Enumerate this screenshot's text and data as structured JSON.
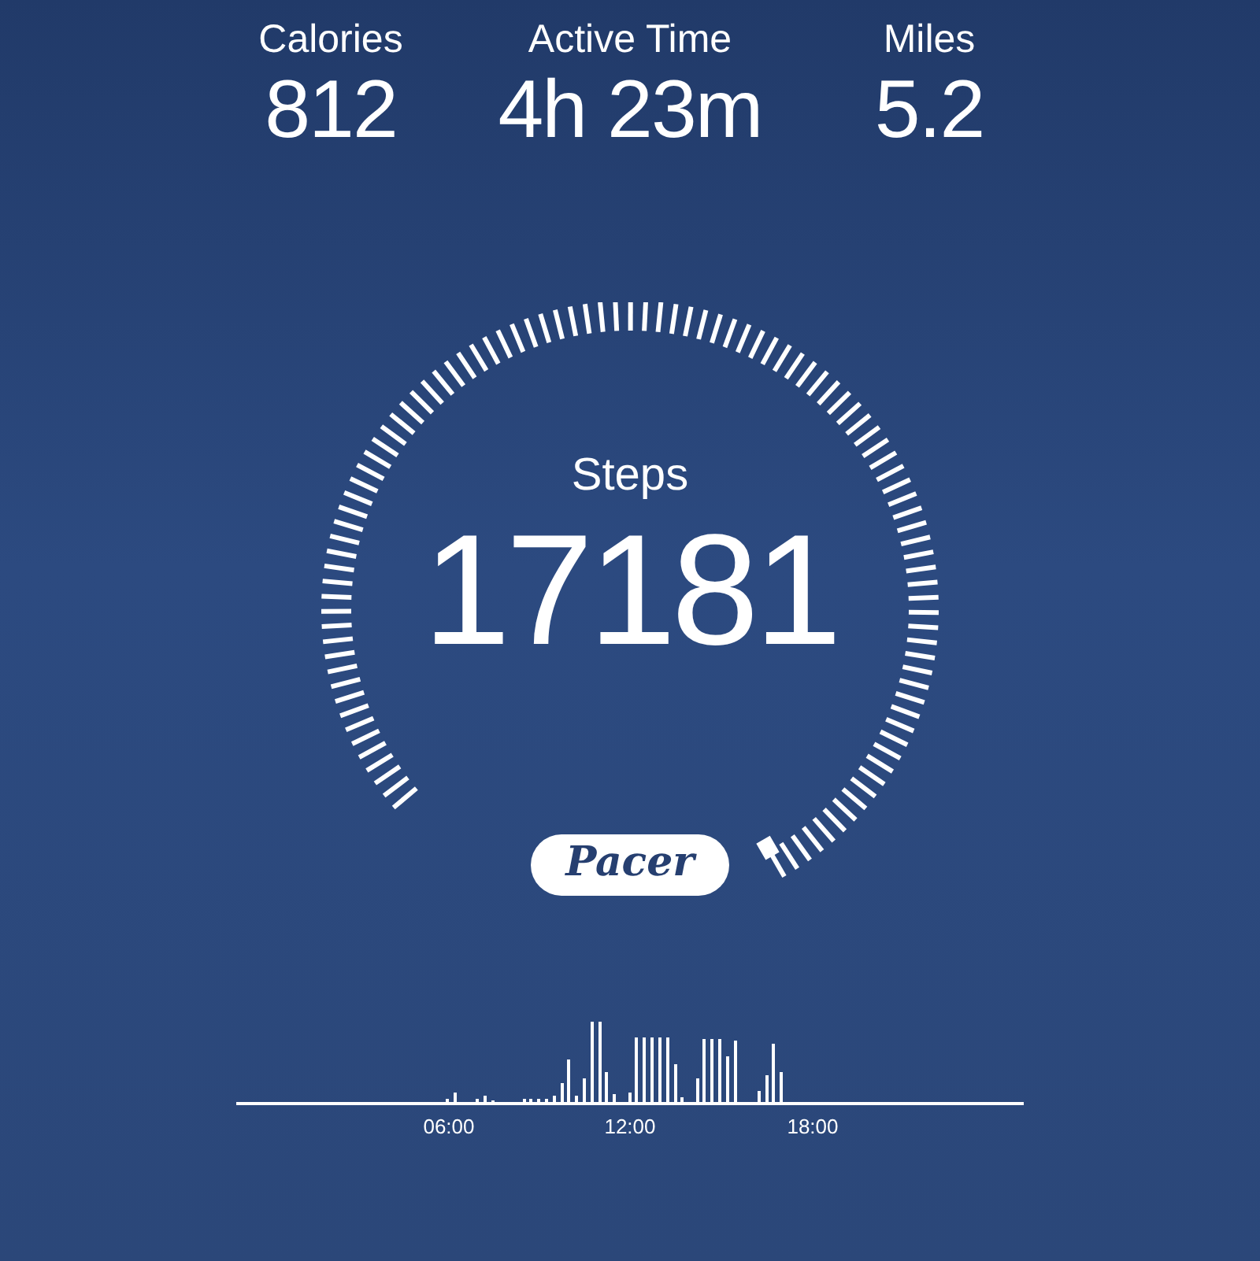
{
  "stats": [
    {
      "label": "Calories",
      "value": "812"
    },
    {
      "label": "Active Time",
      "value": "4h 23m"
    },
    {
      "label": "Miles",
      "value": "5.2"
    }
  ],
  "gauge": {
    "label": "Steps",
    "value": "17181"
  },
  "badge": "Pacer",
  "timeline": {
    "labels": [
      "06:00",
      "12:00",
      "18:00"
    ]
  }
}
